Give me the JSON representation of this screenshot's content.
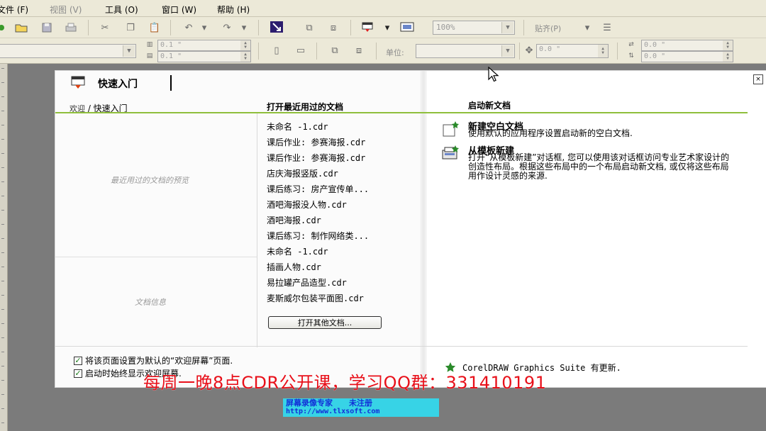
{
  "menu": {
    "file": "文件 (F)",
    "view": "视图 (V)",
    "tools": "工具 (O)",
    "window": "窗口 (W)",
    "help": "帮助 (H)"
  },
  "toolbar": {
    "zoom_value": "100%",
    "snap_label": "贴齐(P)",
    "units_label": "单位:",
    "width_value": "0.1 \"",
    "height_value": "0.1 \"",
    "nudge_value": "0.0 \"",
    "dup_x_value": "0.0 \"",
    "dup_y_value": "0.0 \""
  },
  "welcome": {
    "title": "快速入门",
    "close_icon": "×",
    "breadcrumb_first": "欢迎",
    "breadcrumb_sep": " / ",
    "breadcrumb_current": "快速入门",
    "recent_header": "打开最近用过的文档",
    "new_header": "启动新文档",
    "preview_label": "最近用过的文档的预览",
    "info_label": "文档信息",
    "recent_files": [
      "未命名 -1.cdr",
      "课后作业: 参赛海报.cdr",
      "课后作业: 参赛海报.cdr",
      "店庆海报竖版.cdr",
      "课后练习: 房产宣传单...",
      "酒吧海报没人物.cdr",
      "酒吧海报.cdr",
      "课后练习: 制作网络类...",
      "未命名 -1.cdr",
      "插画人物.cdr",
      "易拉罐产品造型.cdr",
      "麦斯威尔包装平面图.cdr"
    ],
    "open_other_label": "打开其他文档...",
    "new_blank_title": "新建空白文档",
    "new_blank_desc": "使用默认的应用程序设置启动新的空白文档.",
    "from_template_title": "从模板新建",
    "from_template_desc": "打开“从模板新建”对话框, 您可以使用该对话框访问专业艺术家设计的创造性布局。根据这些布局中的一个布局启动新文档, 或仅将这些布局用作设计灵感的来源.",
    "checkbox1_label": "将该页面设置为默认的“欢迎屏幕”页面.",
    "checkbox2_label": "启动时始终显示欢迎屏幕.",
    "checkbox1_checked": true,
    "checkbox2_checked": true,
    "update_text": "CorelDRAW Graphics Suite 有更新."
  },
  "overlay": {
    "banner": "每周一晚8点CDR公开课，学习QQ群：331410191",
    "watermark_line1": "屏幕录像专家      未注册",
    "watermark_line2": "http://www.tlxsoft.com"
  },
  "colors": {
    "accent_green": "#8fbf3c",
    "banner_red": "#e8101a",
    "watermark_bg": "#37d3e6"
  }
}
